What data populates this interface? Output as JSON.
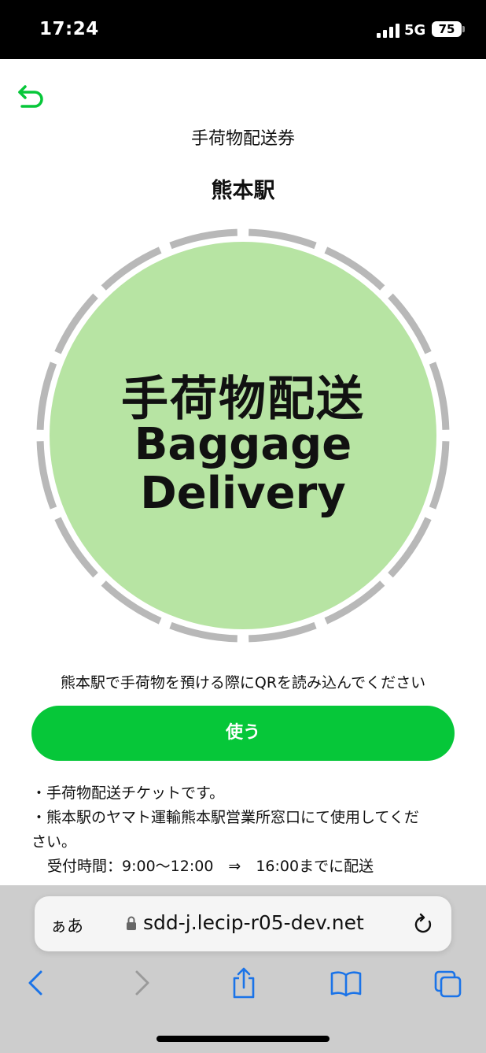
{
  "status_bar": {
    "time": "17:24",
    "network": "5G",
    "battery": "75"
  },
  "header": {
    "subtitle": "手荷物配送券",
    "station": "熊本駅"
  },
  "ticket_image": {
    "line1": "手荷物配送",
    "line2": "Baggage",
    "line3": "Delivery",
    "fill_color": "#b7e4a3",
    "ring_color": "#b8b8b8"
  },
  "instruction": "熊本駅で手荷物を預ける際にQRを読み込んでください",
  "use_button": {
    "label": "使う",
    "color": "#06c739"
  },
  "notes": [
    "・手荷物配送チケットです。",
    "・熊本駅のヤマト運輸熊本駅営業所窓口にて使用してくだ",
    "さい。",
    "受付時間：9:00〜12:00　⇒　16:00までに配送"
  ],
  "browser": {
    "aa_label": "ぁあ",
    "url": "sdd-j.lecip-r05-dev.net",
    "accent_color": "#1a73e8"
  },
  "icons": {
    "back": "undo-arrow-icon",
    "lock": "lock-icon",
    "reload": "reload-icon",
    "nav_back": "chevron-left-icon",
    "nav_forward": "chevron-right-icon",
    "share": "share-icon",
    "bookmarks": "book-icon",
    "tabs": "tabs-icon"
  }
}
